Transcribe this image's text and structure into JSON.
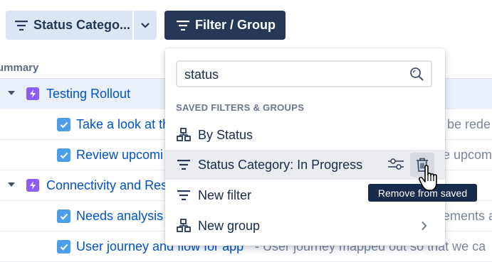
{
  "toolbar": {
    "status_button_label": "Status Catego...",
    "filter_group_label": "Filter / Group"
  },
  "table": {
    "column_header": "ummary",
    "rows": [
      {
        "kind": "epic",
        "title": "Testing Rollout",
        "description": "",
        "selected": true
      },
      {
        "kind": "task",
        "title": "Take a look at th",
        "description": "be rede",
        "selected": false
      },
      {
        "kind": "task",
        "title": "Review upcomi",
        "description": "e upcomi",
        "selected": false
      },
      {
        "kind": "epic",
        "title": "Connectivity and Res",
        "description": "",
        "selected": false
      },
      {
        "kind": "task",
        "title": "Needs analysis",
        "description": "ements a",
        "selected": false
      },
      {
        "kind": "task",
        "title": "User journey and flow for app",
        "description": "- User journey mapped out so that we ca",
        "selected": false
      }
    ]
  },
  "dropdown": {
    "search_value": "status",
    "section_label": "SAVED FILTERS & GROUPS",
    "items": [
      {
        "label": "By Status",
        "icon": "group-icon"
      },
      {
        "label": "Status Category: In Progress",
        "icon": "filter-icon"
      },
      {
        "label": "New filter",
        "icon": "filter-icon"
      },
      {
        "label": "New group",
        "icon": "group-icon"
      }
    ],
    "tooltip": "Remove from saved"
  }
}
